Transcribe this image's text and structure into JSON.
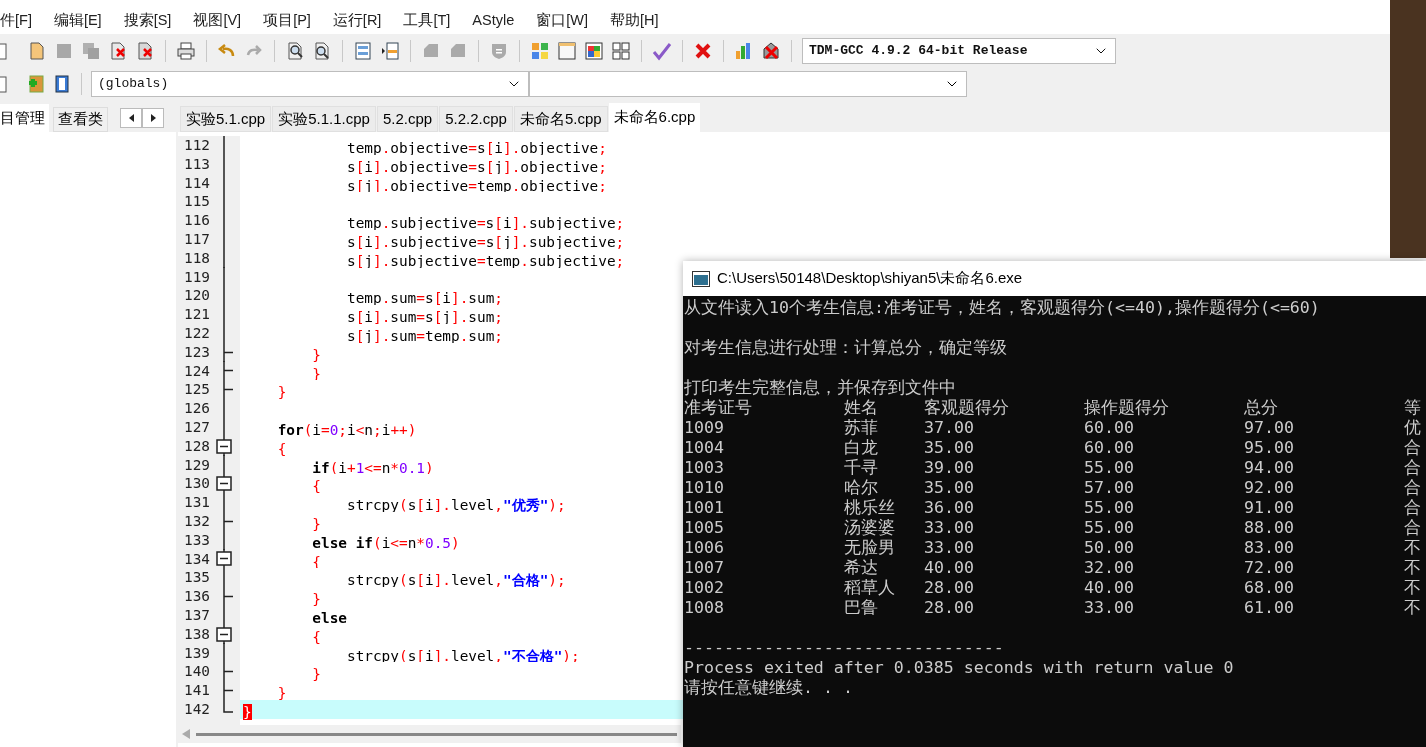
{
  "menu": [
    "件[F]",
    "编辑[E]",
    "搜索[S]",
    "视图[V]",
    "项目[P]",
    "运行[R]",
    "工具[T]",
    "AStyle",
    "窗口[W]",
    "帮助[H]"
  ],
  "toolbar": {
    "compiler": "TDM-GCC 4.9.2 64-bit Release",
    "scope": "(globals)"
  },
  "side_tabs": [
    {
      "label": "目管理",
      "selected": true
    },
    {
      "label": "查看类",
      "selected": false
    }
  ],
  "file_tabs": [
    {
      "label": "实验5.1.cpp",
      "selected": false
    },
    {
      "label": "实验5.1.1.cpp",
      "selected": false
    },
    {
      "label": "5.2.cpp",
      "selected": false
    },
    {
      "label": "5.2.2.cpp",
      "selected": false
    },
    {
      "label": "未命名5.cpp",
      "selected": false
    },
    {
      "label": "未命名6.cpp",
      "selected": true
    }
  ],
  "editor": {
    "lines": [
      {
        "number": "112",
        "kind": "fold_line",
        "current": false,
        "tokens": [
          {
            "kind": "plain",
            "text": "            temp"
          },
          {
            "kind": "op",
            "text": "."
          },
          {
            "kind": "plain",
            "text": "objective"
          },
          {
            "kind": "op",
            "text": "="
          },
          {
            "kind": "plain",
            "text": "s"
          },
          {
            "kind": "op",
            "text": "["
          },
          {
            "kind": "plain",
            "text": "i"
          },
          {
            "kind": "op",
            "text": "]."
          },
          {
            "kind": "plain",
            "text": "objective"
          },
          {
            "kind": "op",
            "text": ";"
          }
        ]
      },
      {
        "number": "113",
        "kind": "fold_line",
        "current": false,
        "tokens": [
          {
            "kind": "plain",
            "text": "            s"
          },
          {
            "kind": "op",
            "text": "["
          },
          {
            "kind": "plain",
            "text": "i"
          },
          {
            "kind": "op",
            "text": "]."
          },
          {
            "kind": "plain",
            "text": "objective"
          },
          {
            "kind": "op",
            "text": "="
          },
          {
            "kind": "plain",
            "text": "s"
          },
          {
            "kind": "op",
            "text": "["
          },
          {
            "kind": "plain",
            "text": "j"
          },
          {
            "kind": "op",
            "text": "]."
          },
          {
            "kind": "plain",
            "text": "objective"
          },
          {
            "kind": "op",
            "text": ";"
          }
        ]
      },
      {
        "number": "114",
        "kind": "fold_line",
        "current": false,
        "tokens": [
          {
            "kind": "plain",
            "text": "            s"
          },
          {
            "kind": "op",
            "text": "["
          },
          {
            "kind": "plain",
            "text": "j"
          },
          {
            "kind": "op",
            "text": "]."
          },
          {
            "kind": "plain",
            "text": "objective"
          },
          {
            "kind": "op",
            "text": "="
          },
          {
            "kind": "plain",
            "text": "temp"
          },
          {
            "kind": "op",
            "text": "."
          },
          {
            "kind": "plain",
            "text": "objective"
          },
          {
            "kind": "op",
            "text": ";"
          }
        ]
      },
      {
        "number": "115",
        "kind": "fold_line",
        "current": false
      },
      {
        "number": "116",
        "kind": "fold_line",
        "current": false,
        "tokens": [
          {
            "kind": "plain",
            "text": "            temp"
          },
          {
            "kind": "op",
            "text": "."
          },
          {
            "kind": "plain",
            "text": "subjective"
          },
          {
            "kind": "op",
            "text": "="
          },
          {
            "kind": "plain",
            "text": "s"
          },
          {
            "kind": "op",
            "text": "["
          },
          {
            "kind": "plain",
            "text": "i"
          },
          {
            "kind": "op",
            "text": "]."
          },
          {
            "kind": "plain",
            "text": "subjective"
          },
          {
            "kind": "op",
            "text": ";"
          }
        ]
      },
      {
        "number": "117",
        "kind": "fold_line",
        "current": false,
        "tokens": [
          {
            "kind": "plain",
            "text": "            s"
          },
          {
            "kind": "op",
            "text": "["
          },
          {
            "kind": "plain",
            "text": "i"
          },
          {
            "kind": "op",
            "text": "]."
          },
          {
            "kind": "plain",
            "text": "subjective"
          },
          {
            "kind": "op",
            "text": "="
          },
          {
            "kind": "plain",
            "text": "s"
          },
          {
            "kind": "op",
            "text": "["
          },
          {
            "kind": "plain",
            "text": "j"
          },
          {
            "kind": "op",
            "text": "]."
          },
          {
            "kind": "plain",
            "text": "subjective"
          },
          {
            "kind": "op",
            "text": ";"
          }
        ]
      },
      {
        "number": "118",
        "kind": "fold_line",
        "current": false,
        "tokens": [
          {
            "kind": "plain",
            "text": "            s"
          },
          {
            "kind": "op",
            "text": "["
          },
          {
            "kind": "plain",
            "text": "j"
          },
          {
            "kind": "op",
            "text": "]."
          },
          {
            "kind": "plain",
            "text": "subjective"
          },
          {
            "kind": "op",
            "text": "="
          },
          {
            "kind": "plain",
            "text": "temp"
          },
          {
            "kind": "op",
            "text": "."
          },
          {
            "kind": "plain",
            "text": "subjective"
          },
          {
            "kind": "op",
            "text": ";"
          }
        ]
      },
      {
        "number": "119",
        "kind": "fold_line",
        "current": false
      },
      {
        "number": "120",
        "kind": "fold_line",
        "current": false,
        "tokens": [
          {
            "kind": "plain",
            "text": "            temp"
          },
          {
            "kind": "op",
            "text": "."
          },
          {
            "kind": "plain",
            "text": "sum"
          },
          {
            "kind": "op",
            "text": "="
          },
          {
            "kind": "plain",
            "text": "s"
          },
          {
            "kind": "op",
            "text": "["
          },
          {
            "kind": "plain",
            "text": "i"
          },
          {
            "kind": "op",
            "text": "]."
          },
          {
            "kind": "plain",
            "text": "sum"
          },
          {
            "kind": "op",
            "text": ";"
          }
        ]
      },
      {
        "number": "121",
        "kind": "fold_line",
        "current": false,
        "tokens": [
          {
            "kind": "plain",
            "text": "            s"
          },
          {
            "kind": "op",
            "text": "["
          },
          {
            "kind": "plain",
            "text": "i"
          },
          {
            "kind": "op",
            "text": "]."
          },
          {
            "kind": "plain",
            "text": "sum"
          },
          {
            "kind": "op",
            "text": "="
          },
          {
            "kind": "plain",
            "text": "s"
          },
          {
            "kind": "op",
            "text": "["
          },
          {
            "kind": "plain",
            "text": "j"
          },
          {
            "kind": "op",
            "text": "]."
          },
          {
            "kind": "plain",
            "text": "sum"
          },
          {
            "kind": "op",
            "text": ";"
          }
        ]
      },
      {
        "number": "122",
        "kind": "fold_line",
        "current": false,
        "tokens": [
          {
            "kind": "plain",
            "text": "            s"
          },
          {
            "kind": "op",
            "text": "["
          },
          {
            "kind": "plain",
            "text": "j"
          },
          {
            "kind": "op",
            "text": "]."
          },
          {
            "kind": "plain",
            "text": "sum"
          },
          {
            "kind": "op",
            "text": "="
          },
          {
            "kind": "plain",
            "text": "temp"
          },
          {
            "kind": "op",
            "text": "."
          },
          {
            "kind": "plain",
            "text": "sum"
          },
          {
            "kind": "op",
            "text": ";"
          }
        ]
      },
      {
        "number": "123",
        "kind": "fold_tick",
        "current": false,
        "tokens": [
          {
            "kind": "op",
            "text": "        }"
          }
        ]
      },
      {
        "number": "124",
        "kind": "fold_tick",
        "current": false,
        "tokens": [
          {
            "kind": "op",
            "text": "        }"
          }
        ]
      },
      {
        "number": "125",
        "kind": "fold_tick",
        "current": false,
        "tokens": [
          {
            "kind": "op",
            "text": "    }"
          }
        ]
      },
      {
        "number": "126",
        "kind": "fold_line",
        "current": false
      },
      {
        "number": "127",
        "kind": "fold_line",
        "current": false,
        "tokens": [
          {
            "kind": "keyword",
            "text": "    for"
          },
          {
            "kind": "op",
            "text": "("
          },
          {
            "kind": "plain",
            "text": "i"
          },
          {
            "kind": "op",
            "text": "="
          },
          {
            "kind": "number",
            "text": "0"
          },
          {
            "kind": "op",
            "text": ";"
          },
          {
            "kind": "plain",
            "text": "i"
          },
          {
            "kind": "op",
            "text": "<"
          },
          {
            "kind": "plain",
            "text": "n"
          },
          {
            "kind": "op",
            "text": ";"
          },
          {
            "kind": "plain",
            "text": "i"
          },
          {
            "kind": "op",
            "text": "++)"
          }
        ]
      },
      {
        "number": "128",
        "kind": "fold_box",
        "current": false,
        "tokens": [
          {
            "kind": "op",
            "text": "    {"
          }
        ]
      },
      {
        "number": "129",
        "kind": "fold_line",
        "current": false,
        "tokens": [
          {
            "kind": "keyword",
            "text": "        if"
          },
          {
            "kind": "op",
            "text": "("
          },
          {
            "kind": "plain",
            "text": "i"
          },
          {
            "kind": "op",
            "text": "+"
          },
          {
            "kind": "number",
            "text": "1"
          },
          {
            "kind": "op",
            "text": "<="
          },
          {
            "kind": "plain",
            "text": "n"
          },
          {
            "kind": "op",
            "text": "*"
          },
          {
            "kind": "number",
            "text": "0.1"
          },
          {
            "kind": "op",
            "text": ")"
          }
        ]
      },
      {
        "number": "130",
        "kind": "fold_box",
        "current": false,
        "tokens": [
          {
            "kind": "op",
            "text": "        {"
          }
        ]
      },
      {
        "number": "131",
        "kind": "fold_line",
        "current": false,
        "tokens": [
          {
            "kind": "plain",
            "text": "            strcpy"
          },
          {
            "kind": "op",
            "text": "("
          },
          {
            "kind": "plain",
            "text": "s"
          },
          {
            "kind": "op",
            "text": "["
          },
          {
            "kind": "plain",
            "text": "i"
          },
          {
            "kind": "op",
            "text": "]."
          },
          {
            "kind": "plain",
            "text": "level"
          },
          {
            "kind": "op",
            "text": ","
          },
          {
            "kind": "string",
            "text": "\"优秀\""
          },
          {
            "kind": "op",
            "text": ");"
          }
        ]
      },
      {
        "number": "132",
        "kind": "fold_tick",
        "current": false,
        "tokens": [
          {
            "kind": "op",
            "text": "        }"
          }
        ]
      },
      {
        "number": "133",
        "kind": "fold_line",
        "current": false,
        "tokens": [
          {
            "kind": "keyword",
            "text": "        else if"
          },
          {
            "kind": "op",
            "text": "("
          },
          {
            "kind": "plain",
            "text": "i"
          },
          {
            "kind": "op",
            "text": "<="
          },
          {
            "kind": "plain",
            "text": "n"
          },
          {
            "kind": "op",
            "text": "*"
          },
          {
            "kind": "number",
            "text": "0.5"
          },
          {
            "kind": "op",
            "text": ")"
          }
        ]
      },
      {
        "number": "134",
        "kind": "fold_box",
        "current": false,
        "tokens": [
          {
            "kind": "op",
            "text": "        {"
          }
        ]
      },
      {
        "number": "135",
        "kind": "fold_line",
        "current": false,
        "tokens": [
          {
            "kind": "plain",
            "text": "            strcpy"
          },
          {
            "kind": "op",
            "text": "("
          },
          {
            "kind": "plain",
            "text": "s"
          },
          {
            "kind": "op",
            "text": "["
          },
          {
            "kind": "plain",
            "text": "i"
          },
          {
            "kind": "op",
            "text": "]."
          },
          {
            "kind": "plain",
            "text": "level"
          },
          {
            "kind": "op",
            "text": ","
          },
          {
            "kind": "string",
            "text": "\"合格\""
          },
          {
            "kind": "op",
            "text": ");"
          }
        ]
      },
      {
        "number": "136",
        "kind": "fold_tick",
        "current": false,
        "tokens": [
          {
            "kind": "op",
            "text": "        }"
          }
        ]
      },
      {
        "number": "137",
        "kind": "fold_line",
        "current": false,
        "tokens": [
          {
            "kind": "keyword",
            "text": "        else"
          }
        ]
      },
      {
        "number": "138",
        "kind": "fold_box",
        "current": false,
        "tokens": [
          {
            "kind": "op",
            "text": "        {"
          }
        ]
      },
      {
        "number": "139",
        "kind": "fold_line",
        "current": false,
        "tokens": [
          {
            "kind": "plain",
            "text": "            strcpy"
          },
          {
            "kind": "op",
            "text": "("
          },
          {
            "kind": "plain",
            "text": "s"
          },
          {
            "kind": "op",
            "text": "["
          },
          {
            "kind": "plain",
            "text": "i"
          },
          {
            "kind": "op",
            "text": "]."
          },
          {
            "kind": "plain",
            "text": "level"
          },
          {
            "kind": "op",
            "text": ","
          },
          {
            "kind": "string",
            "text": "\"不合格\""
          },
          {
            "kind": "op",
            "text": ");"
          }
        ]
      },
      {
        "number": "140",
        "kind": "fold_tick",
        "current": false,
        "tokens": [
          {
            "kind": "op",
            "text": "        }"
          }
        ]
      },
      {
        "number": "141",
        "kind": "fold_tick",
        "current": false,
        "tokens": [
          {
            "kind": "op",
            "text": "    }"
          }
        ]
      },
      {
        "number": "142",
        "kind": "fold_end",
        "current": true,
        "tokens": [
          {
            "kind": "match",
            "text": "}"
          }
        ]
      }
    ]
  },
  "console": {
    "title": "C:\\Users\\50148\\Desktop\\shiyan5\\未命名6.exe",
    "messages": [
      {
        "text": "从文件读入10个考生信息:准考证号，姓名，客观题得分(<=40),操作题得分(<=60)",
        "blank_after": true
      },
      {
        "text": "对考生信息进行处理：计算总分，确定等级",
        "blank_after": true
      },
      {
        "text": "打印考生完整信息，并保存到文件中",
        "blank_after": false
      }
    ],
    "table": {
      "columns": [
        "准考证号",
        "姓名",
        "客观题得分",
        "操作题得分",
        "总分",
        "等"
      ],
      "rows": [
        [
          "1009",
          "苏菲",
          "37.00",
          "60.00",
          "97.00",
          "优"
        ],
        [
          "1004",
          "白龙",
          "35.00",
          "60.00",
          "95.00",
          "合"
        ],
        [
          "1003",
          "千寻",
          "39.00",
          "55.00",
          "94.00",
          "合"
        ],
        [
          "1010",
          "哈尔",
          "35.00",
          "57.00",
          "92.00",
          "合"
        ],
        [
          "1001",
          "桃乐丝",
          "36.00",
          "55.00",
          "91.00",
          "合"
        ],
        [
          "1005",
          "汤婆婆",
          "33.00",
          "55.00",
          "88.00",
          "合"
        ],
        [
          "1006",
          "无脸男",
          "33.00",
          "50.00",
          "83.00",
          "不"
        ],
        [
          "1007",
          "希达",
          "40.00",
          "32.00",
          "72.00",
          "不"
        ],
        [
          "1002",
          "稻草人",
          "28.00",
          "40.00",
          "68.00",
          "不"
        ],
        [
          "1008",
          "巴鲁",
          "28.00",
          "33.00",
          "61.00",
          "不"
        ]
      ]
    },
    "footer": [
      "--------------------------------",
      "Process exited after 0.0385 seconds with return value 0",
      "请按任意键继续. . ."
    ]
  }
}
